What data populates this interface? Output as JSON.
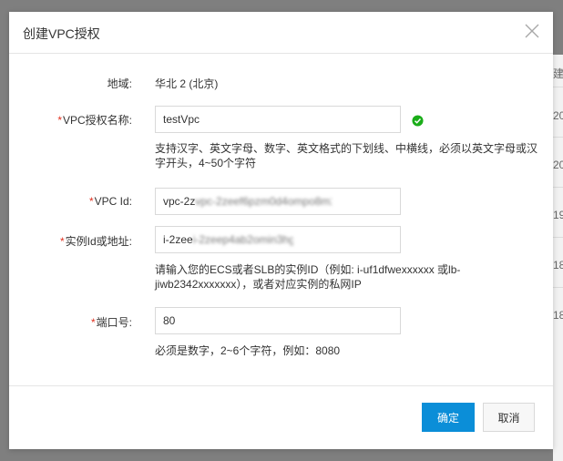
{
  "background": {
    "right_cells": [
      "建时",
      "20",
      "20",
      "19",
      "18",
      "18"
    ]
  },
  "dialog": {
    "title": "创建VPC授权",
    "close_icon": "close-icon",
    "region": {
      "label": "地域:",
      "value": "华北 2 (北京)"
    },
    "vpc_name": {
      "required_mark": "*",
      "label": "VPC授权名称:",
      "value": "testVpc",
      "valid_icon": "check-circle-icon",
      "help": "支持汉字、英文字母、数字、英文格式的下划线、中横线，必须以英文字母或汉字开头，4~50个字符"
    },
    "vpc_id": {
      "required_mark": "*",
      "label": "VPC Id:",
      "value": "vpc-2zeef6pzm0d4ompo8m2kj"
    },
    "instance": {
      "required_mark": "*",
      "label": "实例Id或地址:",
      "value": "i-2zeep4ab2omin3hgi0g",
      "help": "请输入您的ECS或者SLB的实例ID（例如: i-uf1dfwexxxxxx 或lb-jiwb2342xxxxxxx），或者对应实例的私网IP"
    },
    "port": {
      "required_mark": "*",
      "label": "端口号:",
      "value": "80",
      "help": "必须是数字，2~6个字符，例如：8080"
    },
    "confirm_button": "确定",
    "cancel_button": "取消"
  },
  "colors": {
    "primary": "#0b8ed8",
    "required": "#e0301e",
    "valid": "#1aad19"
  }
}
